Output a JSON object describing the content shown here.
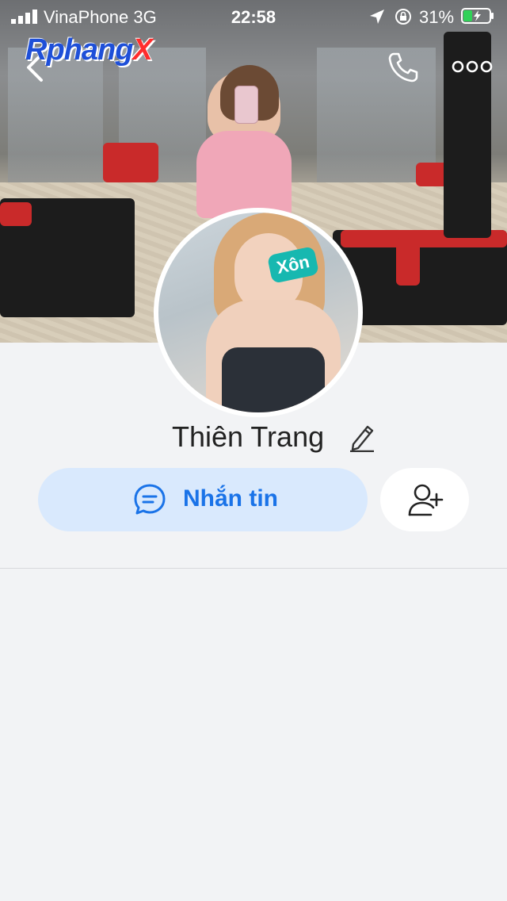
{
  "status_bar": {
    "carrier": "VinaPhone  3G",
    "time": "22:58",
    "battery_percent": "31%"
  },
  "cover": {
    "watermark_main": "Rphang",
    "watermark_x": "X"
  },
  "profile": {
    "name": "Thiên Trang",
    "avatar_sticker": "Xôn"
  },
  "actions": {
    "message_label": "Nhắn tin"
  },
  "colors": {
    "accent_blue": "#1a73e8",
    "message_button_bg": "#d9e9fd",
    "page_bg": "#f2f3f5"
  },
  "icons": {
    "back": "chevron-left-icon",
    "call": "phone-icon",
    "more": "more-dots-icon",
    "edit": "pencil-icon",
    "message": "chat-bubble-icon",
    "add_friend": "add-user-icon"
  }
}
